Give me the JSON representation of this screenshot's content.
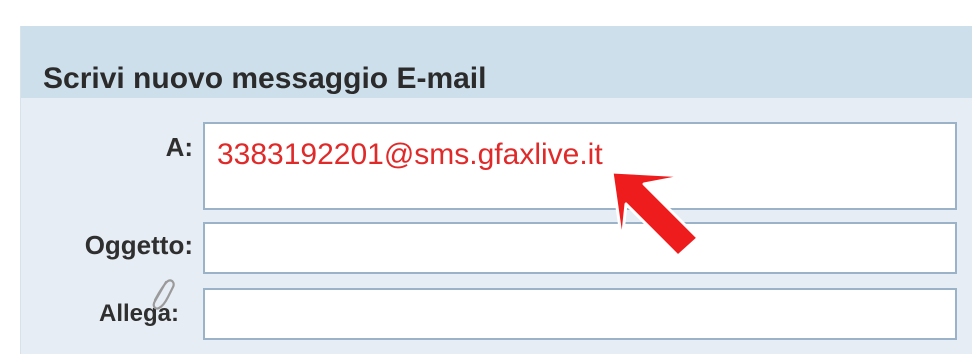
{
  "form": {
    "title": "Scrivi nuovo messaggio E-mail",
    "to_label": "A:",
    "to_value": "3383192201@sms.gfaxlive.it",
    "subject_label": "Oggetto:",
    "subject_value": "",
    "attach_label": "Allega:",
    "attach_value": ""
  },
  "icons": {
    "attach": "paperclip-icon",
    "annotation": "red-arrow-pointer-icon"
  },
  "colors": {
    "header_bg": "#cedfec",
    "panel_bg": "#e7edf4",
    "field_border": "#9ab3c9",
    "to_text": "#e02a2a",
    "arrow": "#ee1c1c"
  }
}
